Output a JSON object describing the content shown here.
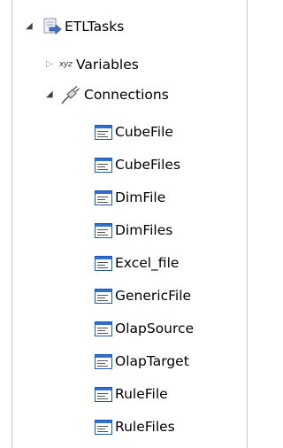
{
  "tree": {
    "root": {
      "label": "ETLTasks",
      "icon": "etl-task-icon",
      "expanded": true
    },
    "variables": {
      "label": "Variables",
      "icon": "xyz-variables-icon",
      "icon_text": "xyz",
      "expanded": false
    },
    "connections": {
      "label": "Connections",
      "icon": "connection-plug-icon",
      "expanded": true,
      "items": [
        {
          "label": "CubeFile",
          "icon": "file-connection-icon"
        },
        {
          "label": "CubeFiles",
          "icon": "file-connection-icon"
        },
        {
          "label": "DimFile",
          "icon": "file-connection-icon"
        },
        {
          "label": "DimFiles",
          "icon": "file-connection-icon"
        },
        {
          "label": "Excel_file",
          "icon": "file-connection-icon"
        },
        {
          "label": "GenericFile",
          "icon": "file-connection-icon"
        },
        {
          "label": "OlapSource",
          "icon": "file-connection-icon"
        },
        {
          "label": "OlapTarget",
          "icon": "file-connection-icon"
        },
        {
          "label": "RuleFile",
          "icon": "file-connection-icon"
        },
        {
          "label": "RuleFiles",
          "icon": "file-connection-icon"
        }
      ]
    }
  }
}
